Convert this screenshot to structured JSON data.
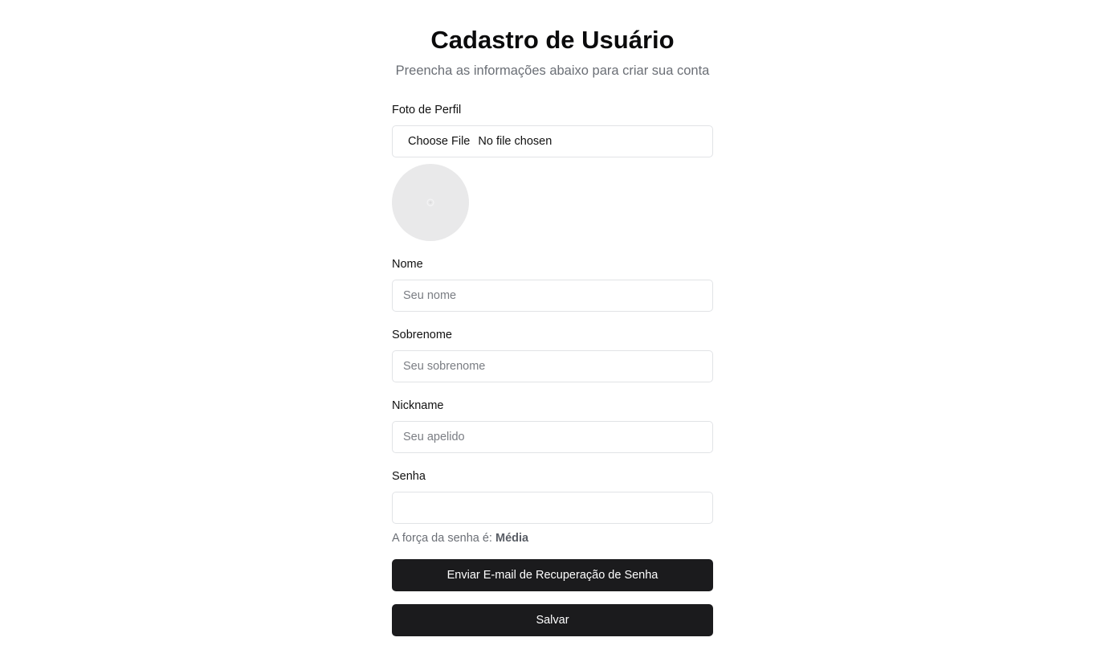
{
  "header": {
    "title": "Cadastro de Usuário",
    "subtitle": "Preencha as informações abaixo para criar sua conta"
  },
  "profile_photo": {
    "label": "Foto de Perfil",
    "choose_button": "Choose File",
    "status": "No file chosen",
    "preview_icon": "image-placeholder-icon"
  },
  "fields": {
    "nome": {
      "label": "Nome",
      "value": "",
      "placeholder": "Seu nome"
    },
    "sobrenome": {
      "label": "Sobrenome",
      "value": "",
      "placeholder": "Seu sobrenome"
    },
    "nickname": {
      "label": "Nickname",
      "value": "",
      "placeholder": "Seu apelido"
    },
    "senha": {
      "label": "Senha",
      "value": "",
      "placeholder": ""
    }
  },
  "password_strength": {
    "prefix": "A força da senha é: ",
    "level": "Média"
  },
  "buttons": {
    "recovery": "Enviar E-mail de Recuperação de Senha",
    "save": "Salvar"
  },
  "colors": {
    "primary_button": "#1b1b1d",
    "muted_text": "#6b6f76",
    "border": "#e1e3e6",
    "avatar_bg": "#e9e9ea"
  }
}
